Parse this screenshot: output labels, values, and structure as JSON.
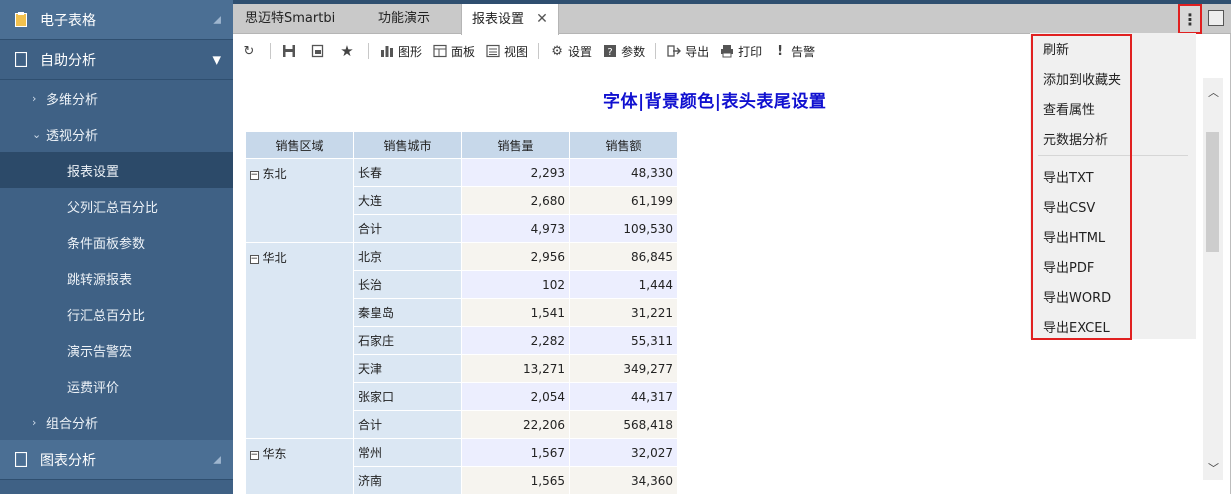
{
  "sidebar": {
    "section1": {
      "label": "电子表格",
      "icon": "spreadsheet-icon"
    },
    "section2": {
      "label": "自助分析",
      "icon": "document-icon"
    },
    "groups": [
      {
        "label": "多维分析"
      },
      {
        "label": "透视分析"
      }
    ],
    "items": [
      {
        "label": "报表设置"
      },
      {
        "label": "父列汇总百分比"
      },
      {
        "label": "条件面板参数"
      },
      {
        "label": "跳转源报表"
      },
      {
        "label": "行汇总百分比"
      },
      {
        "label": "演示告警宏"
      },
      {
        "label": "运费评价"
      }
    ],
    "group3": {
      "label": "组合分析"
    },
    "section3": {
      "label": "图表分析",
      "icon": "chart-icon"
    }
  },
  "tabs": [
    {
      "label": "思迈特Smartbi"
    },
    {
      "label": "功能演示"
    },
    {
      "label": "报表设置",
      "close": "✕"
    }
  ],
  "toolbar": {
    "chart": "图形",
    "panel": "面板",
    "view": "视图",
    "settings": "设置",
    "params": "参数",
    "export": "导出",
    "print": "打印",
    "alert": "告警"
  },
  "report": {
    "title": "字体|背景颜色|表头表尾设置",
    "headers": [
      "销售区域",
      "销售城市",
      "销售量",
      "销售额"
    ],
    "regions": [
      {
        "name": "东北",
        "rows": [
          {
            "city": "长春",
            "qty": "2,293",
            "amount": "48,330"
          },
          {
            "city": "大连",
            "qty": "2,680",
            "amount": "61,199"
          },
          {
            "city": "合计",
            "qty": "4,973",
            "amount": "109,530"
          }
        ]
      },
      {
        "name": "华北",
        "rows": [
          {
            "city": "北京",
            "qty": "2,956",
            "amount": "86,845"
          },
          {
            "city": "长治",
            "qty": "102",
            "amount": "1,444"
          },
          {
            "city": "秦皇岛",
            "qty": "1,541",
            "amount": "31,221"
          },
          {
            "city": "石家庄",
            "qty": "2,282",
            "amount": "55,311"
          },
          {
            "city": "天津",
            "qty": "13,271",
            "amount": "349,277"
          },
          {
            "city": "张家口",
            "qty": "2,054",
            "amount": "44,317"
          },
          {
            "city": "合计",
            "qty": "22,206",
            "amount": "568,418"
          }
        ]
      },
      {
        "name": "华东",
        "rows": [
          {
            "city": "常州",
            "qty": "1,567",
            "amount": "32,027"
          },
          {
            "city": "济南",
            "qty": "1,565",
            "amount": "34,360"
          }
        ]
      }
    ]
  },
  "menu": {
    "group1": [
      "刷新",
      "添加到收藏夹",
      "查看属性",
      "元数据分析"
    ],
    "group2": [
      "导出TXT",
      "导出CSV",
      "导出HTML",
      "导出PDF",
      "导出WORD",
      "导出EXCEL"
    ]
  },
  "colors": {
    "sidebar_bg": "#3f6185",
    "title_color": "#1010d0",
    "highlight_border": "#e02020",
    "header_bg": "#c7d8ea"
  }
}
